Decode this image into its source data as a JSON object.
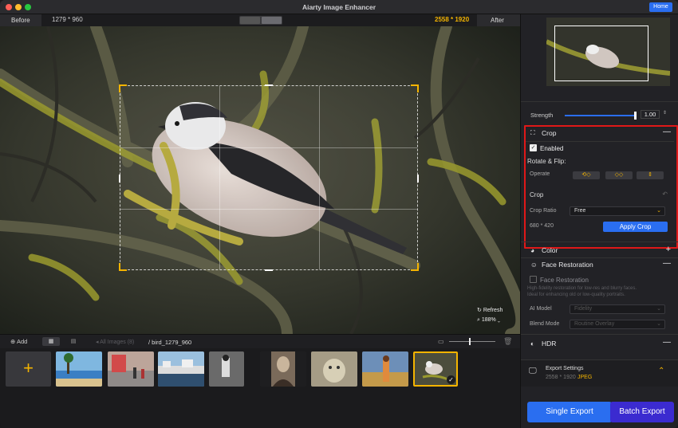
{
  "window": {
    "title": "Aiarty Image Enhancer",
    "home_label": "Home"
  },
  "compare": {
    "before_label": "Before",
    "before_size": "1279 * 960",
    "after_size": "2558 * 1920",
    "after_label": "After"
  },
  "canvas": {
    "refresh_label": "Refresh",
    "zoom": "188%"
  },
  "filmstrip": {
    "add_label": "Add",
    "all_images_label": "All Images (8)",
    "path": "/ bird_1279_960",
    "add_symbol": "+"
  },
  "panel": {
    "strength_label": "Strength",
    "strength_value": "1.00",
    "crop": {
      "title": "Crop",
      "enabled_label": "Enabled",
      "rotate_label": "Rotate & Flip:",
      "operate_label": "Operate",
      "crop_label": "Crop",
      "ratio_label": "Crop Ratio",
      "ratio_value": "Free",
      "size": "680 *  420",
      "apply_label": "Apply Crop"
    },
    "color_title": "Color",
    "face": {
      "title": "Face Restoration",
      "checkbox_label": "Face Restoration",
      "desc": "High-fidelity restoration for low-res and blurry faces. Ideal for enhancing old or low-quality portraits.",
      "model_label": "AI Model",
      "model_value": "Fidelity",
      "blend_label": "Blend Mode",
      "blend_value": "Routine Overlay"
    },
    "hdr_title": "HDR",
    "export": {
      "title": "Export Settings",
      "size": "2558 * 1920",
      "format": "JPEG"
    },
    "single_export": "Single Export",
    "batch_export": "Batch Export"
  },
  "colors": {
    "accent_blue": "#2a6ef0",
    "accent_yellow": "#f4b400",
    "highlight_red": "#e01818",
    "batch_purple": "#3b2bd0"
  }
}
